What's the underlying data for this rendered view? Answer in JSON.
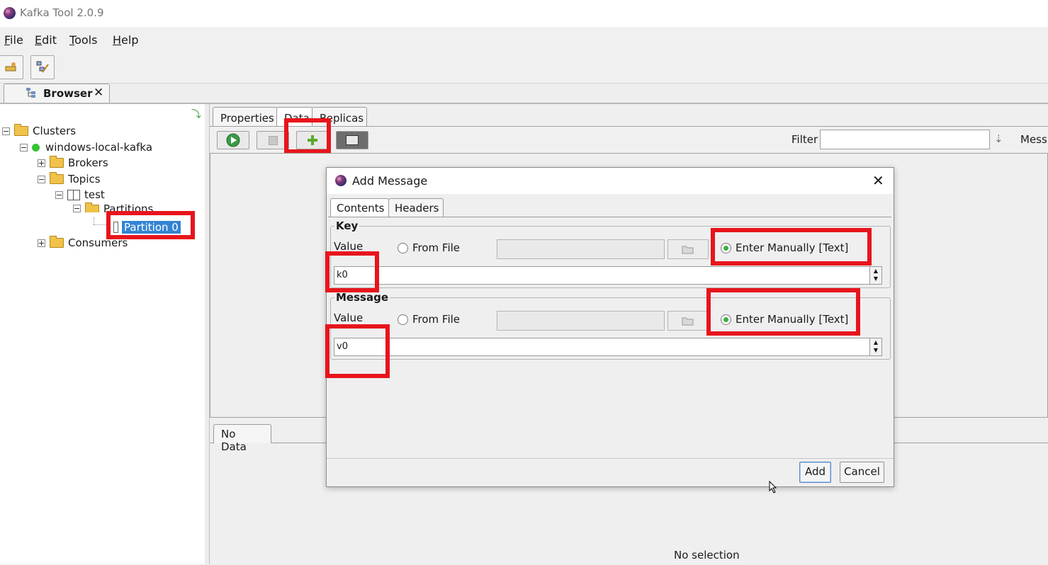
{
  "window": {
    "title": "Kafka Tool  2.0.9"
  },
  "menu": [
    {
      "label": "File",
      "mnemonic": "F",
      "rest": "ile"
    },
    {
      "label": "Edit",
      "mnemonic": "E",
      "rest": "dit"
    },
    {
      "label": "Tools",
      "mnemonic": "T",
      "rest": "ools"
    },
    {
      "label": "Help",
      "mnemonic": "H",
      "rest": "elp"
    }
  ],
  "browser_tab": {
    "label": "Browser",
    "close": "✕"
  },
  "tree": {
    "clusters": "Clusters",
    "cluster_name": "windows-local-kafka",
    "brokers": "Brokers",
    "topics": "Topics",
    "topic": "test",
    "partitions": "Partitions",
    "partition": "Partition 0",
    "consumers": "Consumers"
  },
  "right_tabs": [
    "Properties",
    "Data",
    "Replicas"
  ],
  "filter": {
    "label": "Filter",
    "value": "",
    "next_label": "Mess"
  },
  "bottom": {
    "tab": "No Data",
    "status": "No selection"
  },
  "dialog": {
    "title": "Add Message",
    "close": "✕",
    "tabs": [
      "Contents",
      "Headers"
    ],
    "key": {
      "group_label": "Key",
      "value_label": "Value",
      "from_file_label": "From File",
      "manual_label": "Enter Manually [Text]",
      "manual_selected": true,
      "text": "k0"
    },
    "message": {
      "group_label": "Message",
      "value_label": "Value",
      "from_file_label": "From File",
      "manual_label": "Enter Manually [Text]",
      "manual_selected": true,
      "text": "v0"
    },
    "add_button": "Add",
    "cancel_button": "Cancel"
  },
  "colors": {
    "highlight_box": "#e8141c",
    "selection": "#3484d4",
    "cluster_status": "#35c235"
  }
}
